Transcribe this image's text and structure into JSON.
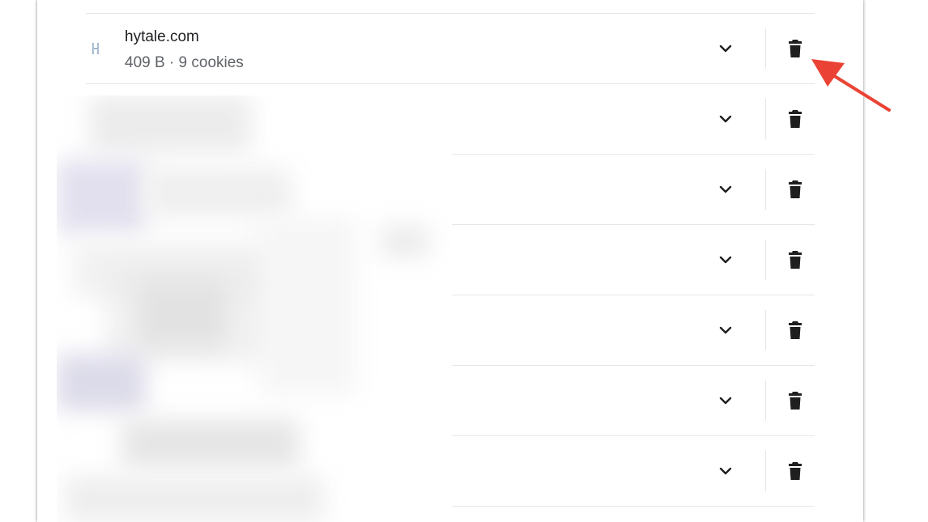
{
  "site_list": {
    "rows": [
      {
        "name": "hytale.com",
        "meta": "409 B · 9 cookies",
        "favicon": "hytale-favicon-icon",
        "blurred": false
      },
      {
        "name": "",
        "meta": "",
        "blurred": true
      },
      {
        "name": "",
        "meta": "",
        "blurred": true
      },
      {
        "name": "",
        "meta": "",
        "blurred": true
      },
      {
        "name": "",
        "meta": "",
        "blurred": true
      },
      {
        "name": "",
        "meta": "",
        "blurred": true
      },
      {
        "name": "",
        "meta": "",
        "blurred": true
      }
    ],
    "row_icons": {
      "expand": "chevron-down-icon",
      "delete": "trash-icon"
    }
  },
  "annotation": {
    "arrow_color": "#ea4335",
    "target": "delete-button of hytale.com row"
  },
  "colors": {
    "divider": "#e6e6e6",
    "text_primary": "#202124",
    "text_secondary": "#5f6368",
    "icon": "#1f1f1f"
  }
}
